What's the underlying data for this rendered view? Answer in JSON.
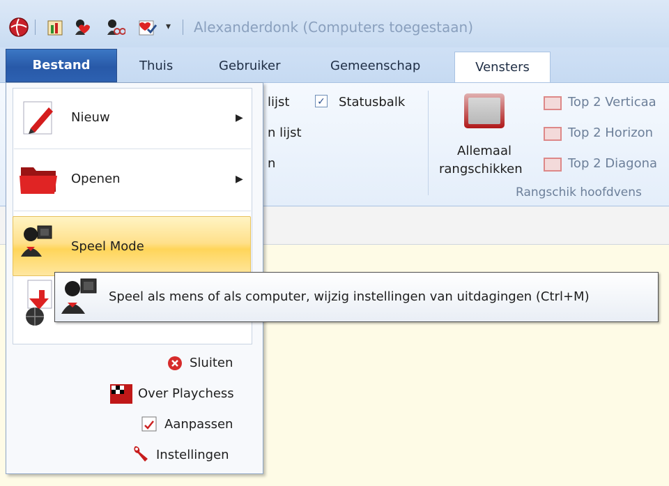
{
  "window": {
    "title": "Alexanderdonk (Computers toegestaan)"
  },
  "quick_access": {
    "icons": [
      "playchess-logo-icon",
      "chart-icon",
      "engine-heart-icon",
      "engine-glasses-icon",
      "engine-check-icon",
      "dropdown-arrow-icon"
    ]
  },
  "tabs": [
    {
      "label": "Bestand"
    },
    {
      "label": "Thuis"
    },
    {
      "label": "Gebruiker"
    },
    {
      "label": "Gemeenschap"
    },
    {
      "label": "Vensters"
    }
  ],
  "ribbon": {
    "partial_1": "lijst",
    "partial_2": "n lijst",
    "partial_3": "n",
    "statusbalk": {
      "label": "Statusbalk",
      "checked": true,
      "checkmark": "✓"
    },
    "allemaal_line1": "Allemaal",
    "allemaal_line2": "rangschikken",
    "top2_vertical": "Top 2 Verticaa",
    "top2_horizontal": "Top 2 Horizon",
    "top2_diagonal": "Top 2 Diagona",
    "group_label": "Rangschik hoofdvens"
  },
  "appmenu": {
    "items": [
      {
        "label": "Nieuw",
        "icon": "pencil-icon",
        "has_submenu": true,
        "arrow": "▶"
      },
      {
        "label": "Openen",
        "icon": "folder-icon",
        "has_submenu": true,
        "arrow": "▶"
      },
      {
        "label": "Speel Mode",
        "icon": "player-chip-icon",
        "highlighted": true
      },
      {
        "label": "",
        "icon": "download-globe-icon"
      }
    ],
    "bottom": [
      {
        "label": "Sluiten",
        "icon": "close-circle-icon"
      },
      {
        "label": "Over Playchess",
        "icon": "checkered-flag-icon"
      },
      {
        "label": "Aanpassen",
        "icon": "customize-icon"
      },
      {
        "label": "Instellingen",
        "icon": "wrench-icon"
      }
    ]
  },
  "tooltip": {
    "text": "Speel als mens of als computer, wijzig instellingen van uitdagingen (Ctrl+M)",
    "icon": "player-chip-icon"
  },
  "colors": {
    "title_bar": "#c9dcf2",
    "bestand_tab": "#2859a8",
    "highlight": "#ffd55a",
    "content_bg": "#fefbe6"
  }
}
